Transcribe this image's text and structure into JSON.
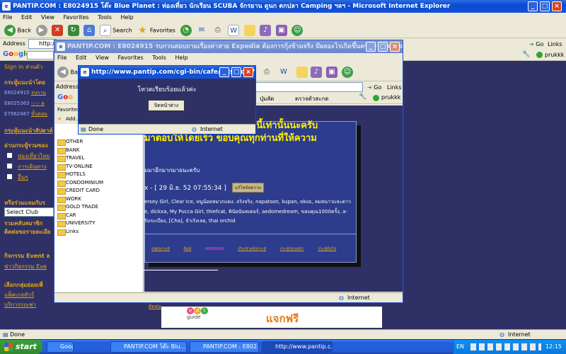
{
  "main_window": {
    "title": "PANTIP.COM : E8024915 โต๊ะ Blue Planet : ท่องเที่ยว นักเรียน SCUBA จักรยาน ดูนก ตกปลา Camping ฯลฯ - Microsoft Internet Explorer",
    "menu": [
      "File",
      "Edit",
      "View",
      "Favorites",
      "Tools",
      "Help"
    ],
    "toolbar": {
      "back": "Back",
      "search": "Search",
      "favorites": "Favorites"
    },
    "address_label": "Address",
    "address_value": "http://www",
    "go_label": "Go",
    "links_label": "Links",
    "google_label": "Google",
    "user": "prukkk",
    "status": "Done",
    "zone": "Internet"
  },
  "left_page": {
    "link1": "Sign in ส่วนตัว",
    "section_recommend": "กระทู้แนะนำโดย",
    "items": [
      {
        "id": "E8024915",
        "text": "รบกวน"
      },
      {
        "id": "E8025363",
        "text": "-:-:- ด"
      },
      {
        "id": "E7962467",
        "text": "ขั้นตอน"
      }
    ],
    "section_recommend2": "กระทู้แนะนำสัปดาห์",
    "section_read": "อ่านกระทู้รวมของ",
    "checks": [
      "ท่องเที่ยวไทย",
      "การเดินทาง",
      "อื่นๆ"
    ],
    "join_label": "หรือร่วมแจมกับร",
    "select_club": "Select Club",
    "club_text1": "รวมคลับสมาชิก",
    "club_text2": "ติดต่อขอรายละเอีย",
    "activity1": "กิจกรรม Event ล",
    "activity2": "ข่าวกิจกรรม Eve",
    "choose_group": "เลือกกลุ่มย่อยเพื่",
    "package": "แพ็คเกจทัวร์",
    "service": "บริการรถเช่า"
  },
  "second_window": {
    "title": "PANTIP.COM : E8024915 รบกวนสอบถามเรื่องค่าสาย Expedia ต้องการกุ้งข้ามจริง มีผลอะไรเกิดขึ้นครับ - Microsoft Interne...",
    "menu": [
      "File",
      "Edit",
      "View",
      "Favorites",
      "Tools",
      "Help"
    ],
    "back": "Back",
    "address_label": "Address",
    "go_label": "Go",
    "links_label": "Links",
    "google_label": "Google",
    "favorites_header": "Favorites",
    "add_label": "Add...",
    "fav_folders": [
      "OTHER",
      "BANK",
      "TRAVEL",
      "TV-ONLINE",
      "HOTELS",
      "CONDOMINIUM",
      "CREDIT CARD",
      "WORK",
      "GOLD TRADE",
      "CAR",
      "UNIVERSITY",
      "Links"
    ],
    "thai_tb1": "ปุ่มลัด",
    "thai_tb2": "ตรวจตัวสะกด",
    "user": "prukkk",
    "page_headline1": "กระทู้นี้เท่านั้นนะครับ",
    "page_headline2": "มาตอบให้โดยเร็ว ขอบคุณทุกท่านที่ให้ความ",
    "page_line3": "มมาอีกมากมายนะครับ",
    "timestamp": "x - [ 29 มิ.ย. 52 07:55:34 ]",
    "reply_badge": "แก้ไขข้อความ",
    "names_line1": "ersey Girl, Clear Ice, หนูน้อยหมวกแดง..จริงจริง, napatson, kupan, okus, ลมหนาวและดาว",
    "names_line2": "e, dickxa, My Pucca Girl, thiefcat, พินัยนันทเตอร์, aedomedream, ขอบคุณ1000ครั้ง, a-",
    "names_line3": "ริมระเบียง, [Cha], จำเริงเลย, thai orchid",
    "footer_links": [
      "ส่งต่อกระทู้",
      "พิมพ์",
      "",
      "เก็บเข้าคลังกระทู้",
      "กระทู้ก่อนหน้า",
      "กระทู้ถัดไป"
    ],
    "zone": "Internet",
    "lower_link": "ติดต่อ"
  },
  "popup": {
    "title": "http://www.pantip.com/cgi-bin/cafe/hits3.cgi?...",
    "message": "โหวตเรียบร้อยแล้วค่ะ",
    "button": "ปิดหน้าต่าง",
    "status": "Done",
    "zone": "Internet"
  },
  "banner": {
    "logo_top": "edt",
    "logo_sub": "guide",
    "text": "แจกฟรี"
  },
  "taskbar": {
    "start": "start",
    "tasks": [
      "Google",
      "PANTIP.COM โต๊ะ Blu...",
      "PANTIP.COM : E802...",
      "http://www.pantip.c..."
    ],
    "lang": "EN",
    "time": "12:15"
  }
}
